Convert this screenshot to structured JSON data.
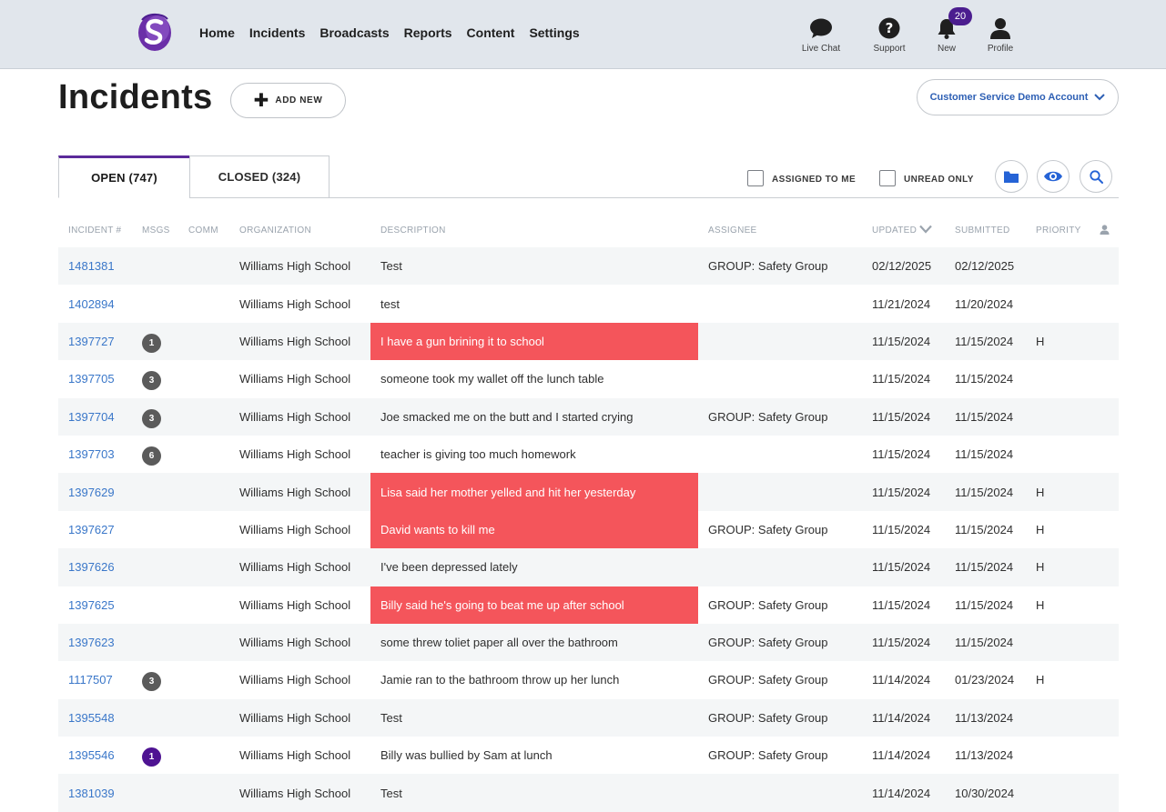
{
  "nav": {
    "links": [
      "Home",
      "Incidents",
      "Broadcasts",
      "Reports",
      "Content",
      "Settings"
    ],
    "live_chat": "Live Chat",
    "support": "Support",
    "new": "New",
    "new_count": "20",
    "profile": "Profile"
  },
  "header": {
    "title": "Incidents",
    "add_new": "ADD NEW",
    "account": "Customer Service Demo Account"
  },
  "tabs": {
    "open": "OPEN (747)",
    "closed": "CLOSED (324)"
  },
  "filters": {
    "assigned_to_me": "ASSIGNED TO ME",
    "unread_only": "UNREAD ONLY"
  },
  "table": {
    "columns": {
      "incident": "INCIDENT #",
      "msgs": "MSGS",
      "comm": "COMM",
      "organization": "ORGANIZATION",
      "description": "DESCRIPTION",
      "assignee": "ASSIGNEE",
      "updated": "UPDATED",
      "submitted": "SUBMITTED",
      "priority": "PRIORITY"
    },
    "rows": [
      {
        "id": "1481381",
        "msgs": "",
        "org": "Williams High School",
        "desc": "Test",
        "assignee": "GROUP: Safety Group",
        "updated": "02/12/2025",
        "submitted": "02/12/2025",
        "priority": ""
      },
      {
        "id": "1402894",
        "msgs": "",
        "org": "Williams High School",
        "desc": "test",
        "assignee": "",
        "updated": "11/21/2024",
        "submitted": "11/20/2024",
        "priority": ""
      },
      {
        "id": "1397727",
        "msgs": "1",
        "org": "Williams High School",
        "desc": "I have a gun brining it to school",
        "assignee": "",
        "updated": "11/15/2024",
        "submitted": "11/15/2024",
        "priority": "H"
      },
      {
        "id": "1397705",
        "msgs": "3",
        "org": "Williams High School",
        "desc": "someone took my wallet off the lunch table",
        "assignee": "",
        "updated": "11/15/2024",
        "submitted": "11/15/2024",
        "priority": ""
      },
      {
        "id": "1397704",
        "msgs": "3",
        "org": "Williams High School",
        "desc": "Joe smacked me on the butt and I started crying",
        "assignee": "GROUP: Safety Group",
        "updated": "11/15/2024",
        "submitted": "11/15/2024",
        "priority": ""
      },
      {
        "id": "1397703",
        "msgs": "6",
        "org": "Williams High School",
        "desc": "teacher is giving too much homework",
        "assignee": "",
        "updated": "11/15/2024",
        "submitted": "11/15/2024",
        "priority": ""
      },
      {
        "id": "1397629",
        "msgs": "",
        "org": "Williams High School",
        "desc": "Lisa said her mother yelled and hit her yesterday",
        "assignee": "",
        "updated": "11/15/2024",
        "submitted": "11/15/2024",
        "priority": "H"
      },
      {
        "id": "1397627",
        "msgs": "",
        "org": "Williams High School",
        "desc": "David wants to kill me",
        "assignee": "GROUP: Safety Group",
        "updated": "11/15/2024",
        "submitted": "11/15/2024",
        "priority": "H"
      },
      {
        "id": "1397626",
        "msgs": "",
        "org": "Williams High School",
        "desc": "I've been depressed lately",
        "assignee": "",
        "updated": "11/15/2024",
        "submitted": "11/15/2024",
        "priority": "H"
      },
      {
        "id": "1397625",
        "msgs": "",
        "org": "Williams High School",
        "desc": "Billy said he's going to beat me up after school",
        "assignee": "GROUP: Safety Group",
        "updated": "11/15/2024",
        "submitted": "11/15/2024",
        "priority": "H"
      },
      {
        "id": "1397623",
        "msgs": "",
        "org": "Williams High School",
        "desc": "some threw toliet paper all over the bathroom",
        "assignee": "GROUP: Safety Group",
        "updated": "11/15/2024",
        "submitted": "11/15/2024",
        "priority": ""
      },
      {
        "id": "1117507",
        "msgs": "3",
        "org": "Williams High School",
        "desc": "Jamie ran to the bathroom throw up her lunch",
        "assignee": "GROUP: Safety Group",
        "updated": "11/14/2024",
        "submitted": "01/23/2024",
        "priority": "H"
      },
      {
        "id": "1395548",
        "msgs": "",
        "org": "Williams High School",
        "desc": "Test",
        "assignee": "GROUP: Safety Group",
        "updated": "11/14/2024",
        "submitted": "11/13/2024",
        "priority": ""
      },
      {
        "id": "1395546",
        "msgs": "1",
        "org": "Williams High School",
        "desc": "Billy was bullied by Sam at lunch",
        "assignee": "GROUP: Safety Group",
        "updated": "11/14/2024",
        "submitted": "11/13/2024",
        "priority": ""
      },
      {
        "id": "1381039",
        "msgs": "",
        "org": "Williams High School",
        "desc": "Test",
        "assignee": "",
        "updated": "11/14/2024",
        "submitted": "10/30/2024",
        "priority": ""
      }
    ]
  },
  "colors": {
    "flag_red": "#f4555b",
    "brand_purple": "#4e1392",
    "link_blue": "#3a77c9",
    "alt_row": "#f4f6f7"
  }
}
